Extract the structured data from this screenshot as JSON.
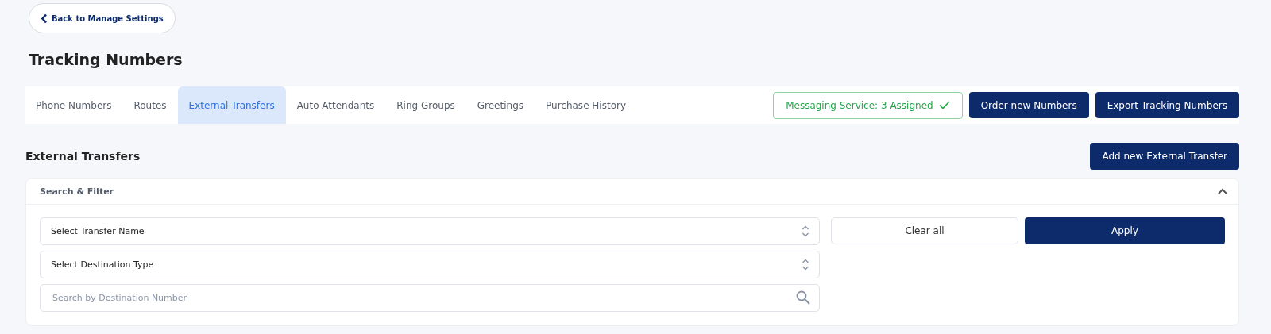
{
  "back_button": {
    "label": "Back to Manage Settings"
  },
  "page_title": "Tracking Numbers",
  "tabs": [
    {
      "label": "Phone Numbers",
      "selected": false
    },
    {
      "label": "Routes",
      "selected": false
    },
    {
      "label": "External Transfers",
      "selected": true
    },
    {
      "label": "Auto Attendants",
      "selected": false
    },
    {
      "label": "Ring Groups",
      "selected": false
    },
    {
      "label": "Greetings",
      "selected": false
    },
    {
      "label": "Purchase History",
      "selected": false
    }
  ],
  "messaging_status": {
    "label": "Messaging Service: 3 Assigned",
    "ok": true
  },
  "header_buttons": [
    "Order new Numbers",
    "Export Tracking Numbers"
  ],
  "section_title": "External Transfers",
  "add_button": "Add new External Transfer",
  "filter": {
    "title": "Search & Filter",
    "expanded": true,
    "fields": [
      {
        "kind": "select",
        "value": "Select Transfer Name"
      },
      {
        "kind": "select",
        "value": "Select Destination Type"
      },
      {
        "kind": "search",
        "placeholder": "Search by Destination Number"
      }
    ],
    "clear_button": "Clear all",
    "apply_button": "Apply"
  }
}
